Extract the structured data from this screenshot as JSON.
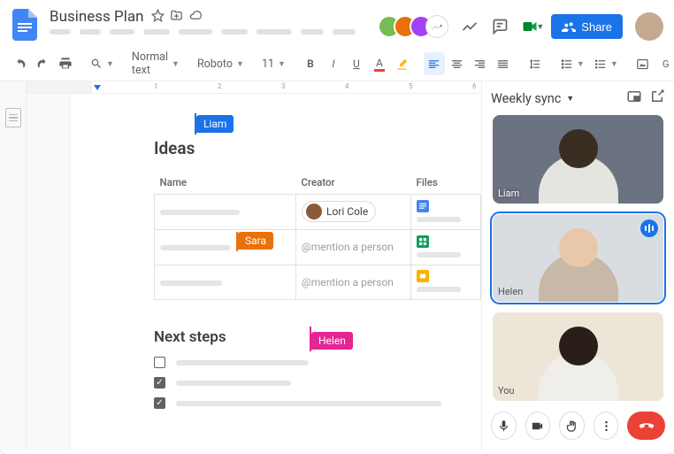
{
  "doc": {
    "title": "Business Plan",
    "star": false
  },
  "toolbar": {
    "style": "Normal text",
    "font": "Roboto",
    "size": "11"
  },
  "share": {
    "label": "Share"
  },
  "content": {
    "heading_ideas": "Ideas",
    "heading_next": "Next steps",
    "tbl": {
      "cols": {
        "name": "Name",
        "creator": "Creator",
        "files": "Files"
      },
      "creator_chip": "Lori Cole",
      "mention_placeholder": "@mention a person"
    },
    "cursors": {
      "liam": "Liam",
      "sara": "Sara",
      "helen": "Helen"
    },
    "checks": [
      {
        "checked": false
      },
      {
        "checked": true
      },
      {
        "checked": true
      }
    ]
  },
  "meet": {
    "title": "Weekly sync",
    "tiles": [
      {
        "name": "Liam",
        "active": false,
        "speaking": false
      },
      {
        "name": "Helen",
        "active": true,
        "speaking": true
      },
      {
        "name": "You",
        "active": false,
        "speaking": false
      }
    ]
  }
}
